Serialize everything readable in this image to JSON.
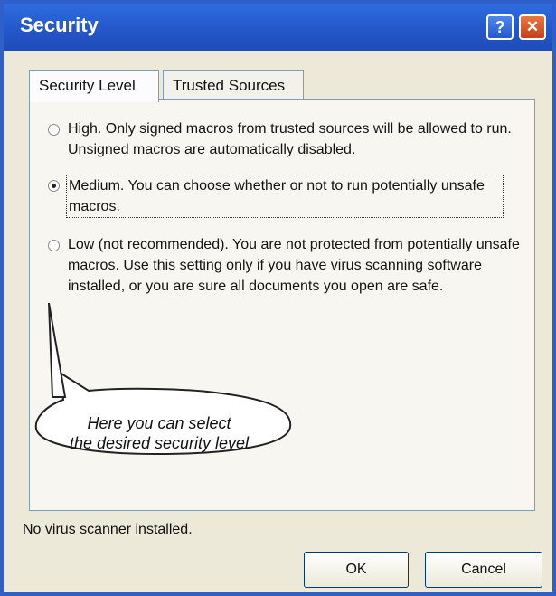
{
  "window": {
    "title": "Security"
  },
  "titlebar_buttons": {
    "help": "?",
    "close": "✕"
  },
  "tabs": [
    {
      "label": "Security Level",
      "active": true
    },
    {
      "label": "Trusted Sources",
      "active": false
    }
  ],
  "options": [
    {
      "label": "High. Only signed macros from trusted sources will be allowed to run. Unsigned macros are automatically disabled.",
      "selected": false
    },
    {
      "label": "Medium. You can choose whether or not to run potentially unsafe macros.",
      "selected": true
    },
    {
      "label": "Low (not recommended). You are not protected from potentially unsafe macros. Use this setting only if you have virus scanning software installed, or you are sure all documents you open are safe.",
      "selected": false
    }
  ],
  "callout": {
    "line1": "Here you can select",
    "line2": "the desired security level"
  },
  "status": "No virus scanner installed.",
  "buttons": {
    "ok": "OK",
    "cancel": "Cancel"
  },
  "colors": {
    "titlebar": "#2457c9",
    "close": "#c3431c"
  }
}
